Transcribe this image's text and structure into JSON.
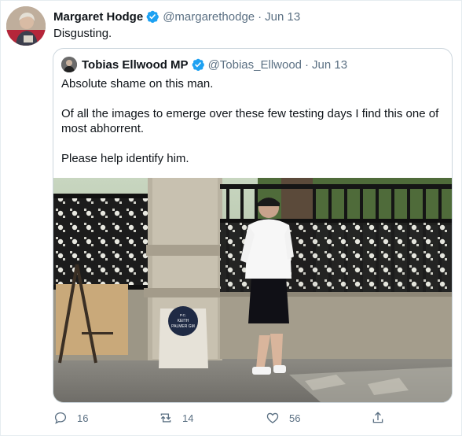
{
  "tweet": {
    "author_name": "Margaret Hodge",
    "author_handle": "@margarethodge",
    "separator": "·",
    "date": "Jun 13",
    "text": "Disgusting.",
    "avatar_icon": "profile-photo",
    "verified_icon": "verified-badge-icon"
  },
  "quoted_tweet": {
    "author_name": "Tobias Ellwood MP",
    "author_handle": "@Tobias_Ellwood",
    "separator": "·",
    "date": "Jun 13",
    "paragraphs": [
      "Absolute shame on this man.",
      "Of all the images to emerge over these few testing days I find this one of most abhorrent.",
      "Please help identify him."
    ],
    "image": {
      "memorial_plaque_lines": [
        "IN REMEMBRANCE",
        "P.C.",
        "KEITH",
        "PALMER GM",
        "22 MARCH 2017"
      ]
    }
  },
  "actions": {
    "reply_count": "16",
    "retweet_count": "14",
    "like_count": "56",
    "reply_icon": "reply-icon",
    "retweet_icon": "retweet-icon",
    "like_icon": "heart-icon",
    "share_icon": "share-icon"
  },
  "colors": {
    "verified_blue": "#1da1f2",
    "secondary_text": "#5b7083",
    "border": "#ccd6dd"
  }
}
